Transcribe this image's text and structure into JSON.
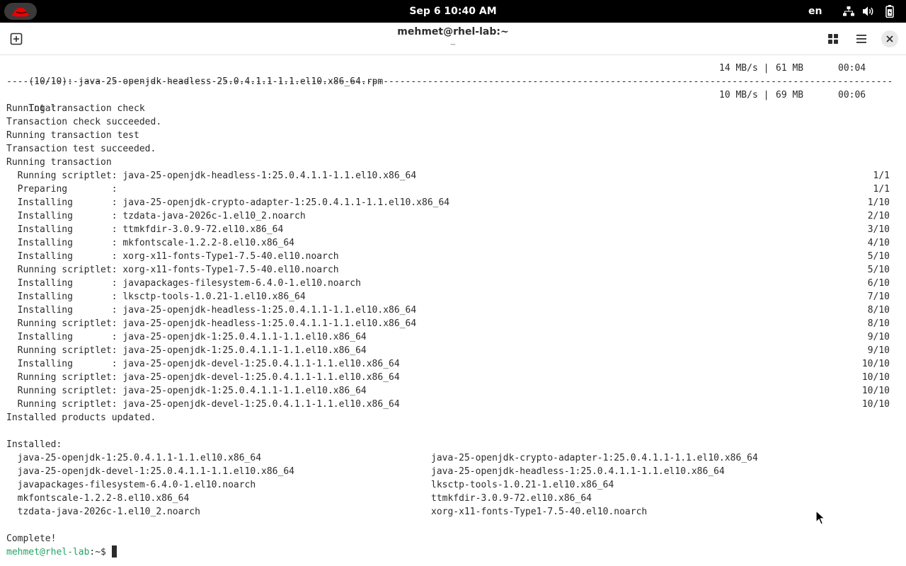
{
  "topbar": {
    "clock": "Sep 6  10:40 AM",
    "language": "en",
    "icons": [
      "redhat-logo-icon",
      "network-icon",
      "volume-icon",
      "battery-icon"
    ]
  },
  "header": {
    "title": "mehmet@rhel-lab:~",
    "subtitle": "~",
    "icons": [
      "new-tab-icon",
      "tab-overview-icon",
      "menu-icon",
      "close-icon"
    ]
  },
  "download": {
    "name": "(10/10): java-25-openjdk-headless-25.0.4.1.1-1.1.el10.x86_64.rpm",
    "speed": "14 MB/s |",
    "size": "61 MB",
    "time": "00:04"
  },
  "separator": "------------------------------------------------------------------------------------------------------------------------------------------------------------------------------------------------------------",
  "total": {
    "label": "Total",
    "speed": "10 MB/s |",
    "size": "69 MB",
    "time": "00:06"
  },
  "status_lines": [
    "Running transaction check",
    "Transaction check succeeded.",
    "Running transaction test",
    "Transaction test succeeded.",
    "Running transaction"
  ],
  "steps": [
    {
      "text": "  Running scriptlet: java-25-openjdk-headless-1:25.0.4.1.1-1.1.el10.x86_64",
      "progress": "1/1"
    },
    {
      "text": "  Preparing        :",
      "progress": "1/1"
    },
    {
      "text": "  Installing       : java-25-openjdk-crypto-adapter-1:25.0.4.1.1-1.1.el10.x86_64",
      "progress": "1/10"
    },
    {
      "text": "  Installing       : tzdata-java-2026c-1.el10_2.noarch",
      "progress": "2/10"
    },
    {
      "text": "  Installing       : ttmkfdir-3.0.9-72.el10.x86_64",
      "progress": "3/10"
    },
    {
      "text": "  Installing       : mkfontscale-1.2.2-8.el10.x86_64",
      "progress": "4/10"
    },
    {
      "text": "  Installing       : xorg-x11-fonts-Type1-7.5-40.el10.noarch",
      "progress": "5/10"
    },
    {
      "text": "  Running scriptlet: xorg-x11-fonts-Type1-7.5-40.el10.noarch",
      "progress": "5/10"
    },
    {
      "text": "  Installing       : javapackages-filesystem-6.4.0-1.el10.noarch",
      "progress": "6/10"
    },
    {
      "text": "  Installing       : lksctp-tools-1.0.21-1.el10.x86_64",
      "progress": "7/10"
    },
    {
      "text": "  Installing       : java-25-openjdk-headless-1:25.0.4.1.1-1.1.el10.x86_64",
      "progress": "8/10"
    },
    {
      "text": "  Running scriptlet: java-25-openjdk-headless-1:25.0.4.1.1-1.1.el10.x86_64",
      "progress": "8/10"
    },
    {
      "text": "  Installing       : java-25-openjdk-1:25.0.4.1.1-1.1.el10.x86_64",
      "progress": "9/10"
    },
    {
      "text": "  Running scriptlet: java-25-openjdk-1:25.0.4.1.1-1.1.el10.x86_64",
      "progress": "9/10"
    },
    {
      "text": "  Installing       : java-25-openjdk-devel-1:25.0.4.1.1-1.1.el10.x86_64",
      "progress": "10/10"
    },
    {
      "text": "  Running scriptlet: java-25-openjdk-devel-1:25.0.4.1.1-1.1.el10.x86_64",
      "progress": "10/10"
    },
    {
      "text": "  Running scriptlet: java-25-openjdk-1:25.0.4.1.1-1.1.el10.x86_64",
      "progress": "10/10"
    },
    {
      "text": "  Running scriptlet: java-25-openjdk-devel-1:25.0.4.1.1-1.1.el10.x86_64",
      "progress": "10/10"
    }
  ],
  "products_updated": "Installed products updated.",
  "installed_label": "Installed:",
  "installed": [
    [
      "  java-25-openjdk-1:25.0.4.1.1-1.1.el10.x86_64",
      "java-25-openjdk-crypto-adapter-1:25.0.4.1.1-1.1.el10.x86_64"
    ],
    [
      "  java-25-openjdk-devel-1:25.0.4.1.1-1.1.el10.x86_64",
      "java-25-openjdk-headless-1:25.0.4.1.1-1.1.el10.x86_64"
    ],
    [
      "  javapackages-filesystem-6.4.0-1.el10.noarch",
      "lksctp-tools-1.0.21-1.el10.x86_64"
    ],
    [
      "  mkfontscale-1.2.2-8.el10.x86_64",
      "ttmkfdir-3.0.9-72.el10.x86_64"
    ],
    [
      "  tzdata-java-2026c-1.el10_2.noarch",
      "xorg-x11-fonts-Type1-7.5-40.el10.noarch"
    ]
  ],
  "complete": "Complete!",
  "prompt": {
    "user_host": "mehmet@rhel-lab",
    "path": ":~$ "
  },
  "colors": {
    "topbar_bg": "#000000",
    "terminal_bg": "#ffffff",
    "terminal_fg": "#2b2b2b",
    "prompt_green": "#26a269",
    "redhat_red": "#ee0000"
  }
}
